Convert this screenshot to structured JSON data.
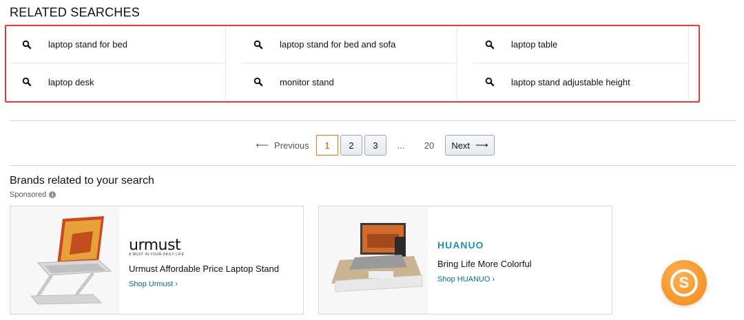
{
  "related": {
    "title": "RELATED SEARCHES",
    "items": [
      "laptop stand for bed",
      "laptop stand for bed and sofa",
      "laptop table",
      "laptop desk",
      "monitor stand",
      "laptop stand adjustable height"
    ]
  },
  "pagination": {
    "previous": "Previous",
    "pages": [
      "1",
      "2",
      "3"
    ],
    "ellipsis": "...",
    "last": "20",
    "next": "Next",
    "current": "1"
  },
  "brands": {
    "title": "Brands related to your search",
    "sponsored": "Sponsored",
    "cards": [
      {
        "logo": "urmust",
        "logo_tagline": "A MUST IN YOUR DAILY LIFE",
        "tagline": "Urmust Affordable Price Laptop Stand",
        "shop": "Shop Urmust ›"
      },
      {
        "logo": "HUANUO",
        "tagline": "Bring Life More Colorful",
        "shop": "Shop HUANUO ›"
      }
    ]
  },
  "colors": {
    "highlight_border": "#e53935",
    "link": "#007185",
    "active_page": "#c45500",
    "fab": "#f08a1a"
  }
}
